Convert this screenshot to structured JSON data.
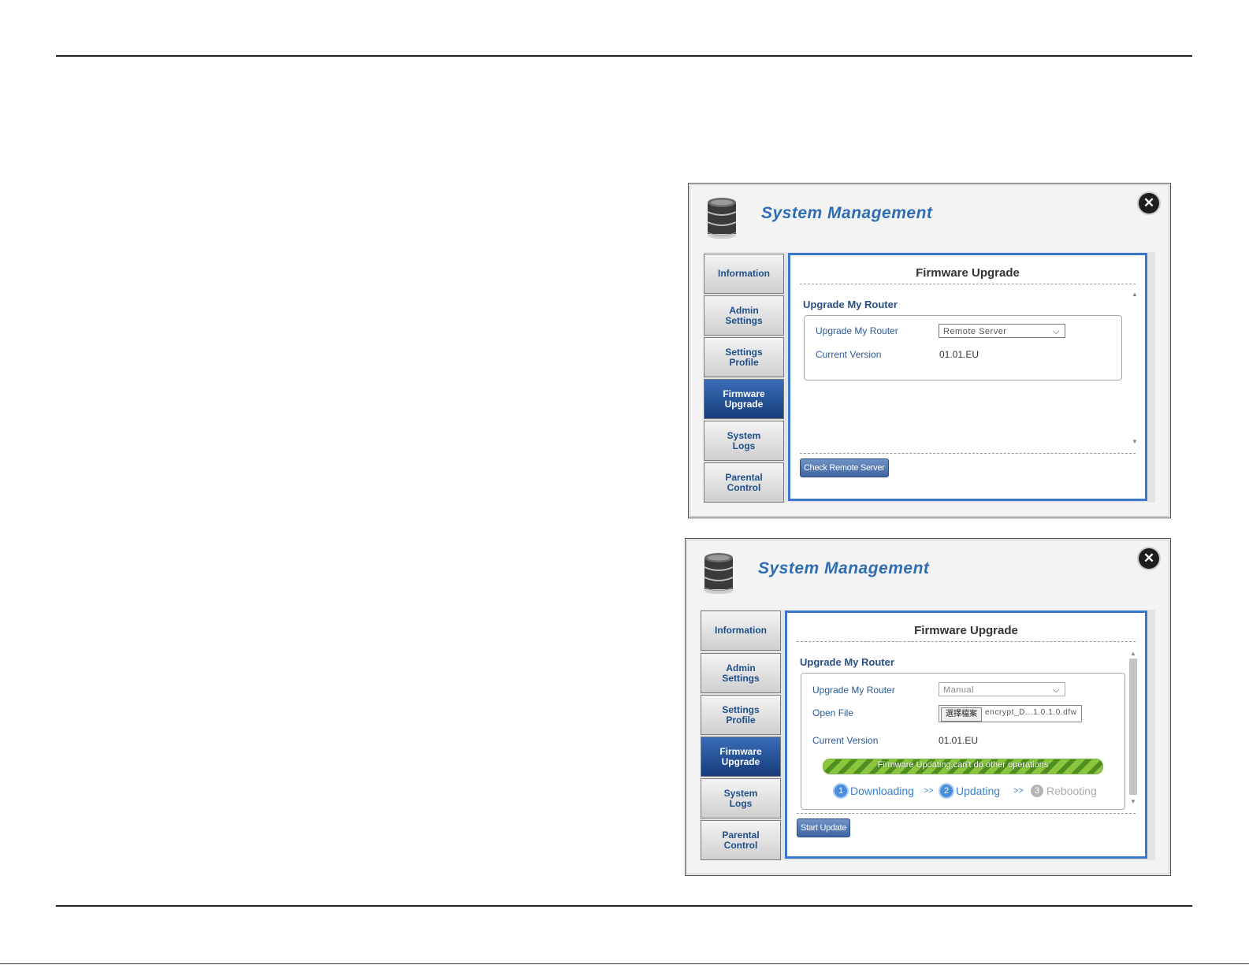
{
  "panel1": {
    "title": "System Management",
    "nav": [
      "Information",
      "Admin\nSettings",
      "Settings\nProfile",
      "Firmware\nUpgrade",
      "System\nLogs",
      "Parental\nControl"
    ],
    "content_title": "Firmware Upgrade",
    "section_title": "Upgrade My Router",
    "upgrade_label": "Upgrade My Router",
    "upgrade_value": "Remote Server",
    "version_label": "Current Version",
    "version_value": "01.01.EU",
    "button": "Check Remote Server"
  },
  "panel2": {
    "title": "System Management",
    "nav": [
      "Information",
      "Admin\nSettings",
      "Settings\nProfile",
      "Firmware\nUpgrade",
      "System\nLogs",
      "Parental\nControl"
    ],
    "content_title": "Firmware Upgrade",
    "section_title": "Upgrade My Router",
    "upgrade_label": "Upgrade My Router",
    "upgrade_value": "Manual",
    "open_file_label": "Open File",
    "file_button": "選擇檔案",
    "file_name": "encrypt_D...1.0.1.0.dfw",
    "version_label": "Current Version",
    "version_value": "01.01.EU",
    "progress_text": "Firmware Updating,can't do other operations",
    "progress_fraction": 1.0,
    "steps": [
      {
        "num": "1",
        "label": "Downloading"
      },
      {
        "num": "2",
        "label": "Updating"
      },
      {
        "num": "3",
        "label": "Rebooting"
      }
    ],
    "step_sep": ">>",
    "button": "Start Update"
  },
  "icons": {
    "close": "close-icon",
    "database": "database-icon"
  },
  "colors": {
    "accent": "#2e6db4",
    "active_nav": "#1e4a8e",
    "content_border": "#3a78d0",
    "progress": "#8cc63f"
  }
}
